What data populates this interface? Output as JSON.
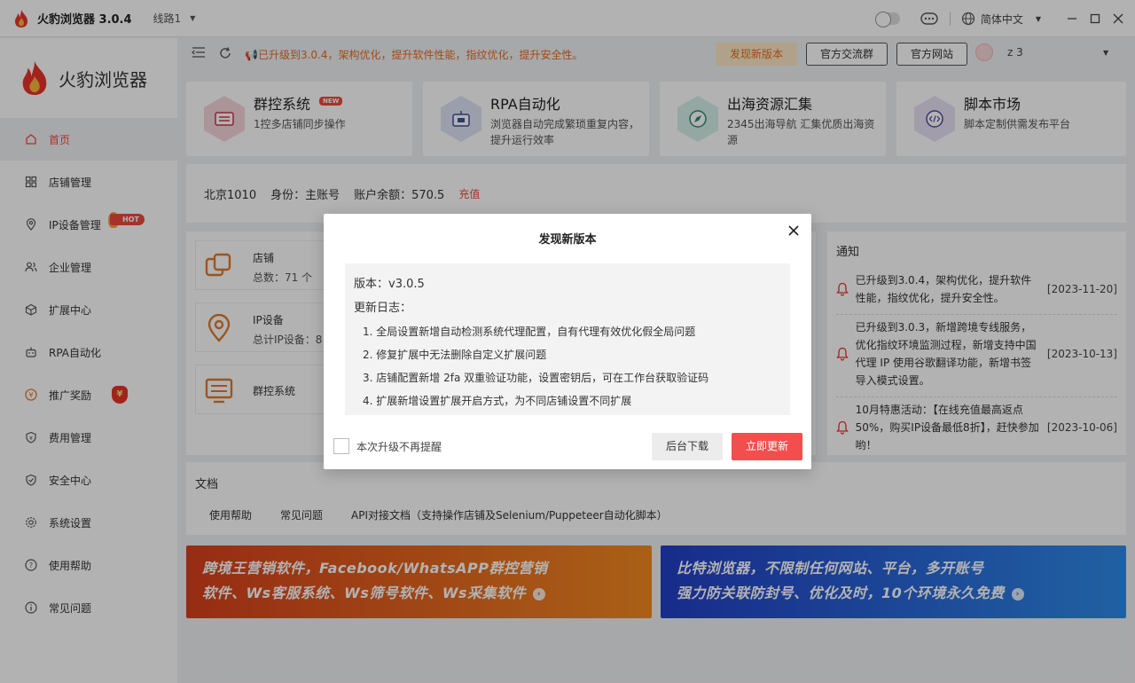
{
  "titlebar": {
    "app_name": "火豹浏览器 3.0.4",
    "line_label": "线路1",
    "language": "简体中文"
  },
  "sidebar": {
    "brand": "火豹浏览器",
    "hot_label": "HOT",
    "items": [
      {
        "label": "首页",
        "icon": "home-icon"
      },
      {
        "label": "店铺管理",
        "icon": "grid-icon"
      },
      {
        "label": "IP设备管理",
        "icon": "location-icon"
      },
      {
        "label": "企业管理",
        "icon": "users-icon"
      },
      {
        "label": "扩展中心",
        "icon": "cube-icon"
      },
      {
        "label": "RPA自动化",
        "icon": "robot-icon"
      },
      {
        "label": "推广奖励",
        "icon": "coin-icon"
      },
      {
        "label": "费用管理",
        "icon": "shield-yen-icon"
      },
      {
        "label": "安全中心",
        "icon": "shield-check-icon"
      },
      {
        "label": "系统设置",
        "icon": "gear-icon"
      },
      {
        "label": "使用帮助",
        "icon": "help-icon"
      },
      {
        "label": "常见问题",
        "icon": "info-icon"
      }
    ]
  },
  "topbar": {
    "notice": "已升级到3.0.4，架构优化，提升软件性能，指纹优化，提升安全性。",
    "new_version_btn": "发现新版本",
    "group_btn": "官方交流群",
    "site_btn": "官方网站",
    "username": "z                  3"
  },
  "features": [
    {
      "title": "群控系统",
      "desc": "1控多店铺同步操作",
      "badge": "NEW",
      "color": "#f7d6dc"
    },
    {
      "title": "RPA自动化",
      "desc": "浏览器自动完成繁琐重复内容，提升运行效率",
      "color": "#dfe4f5"
    },
    {
      "title": "出海资源汇集",
      "desc": "2345出海导航 汇集优质出海资源",
      "color": "#d6efe9"
    },
    {
      "title": "脚本市场",
      "desc": "脚本定制供需发布平台",
      "color": "#e7e1f5"
    }
  ],
  "account": {
    "region": "北京1010",
    "identity": "身份：主账号",
    "balance": "账户余额：570.5",
    "recharge": "充值"
  },
  "stats": {
    "store_title": "店铺",
    "store_sub": "总数：71 个",
    "ip_title": "IP设备",
    "ip_sub": "总计IP设备：8",
    "group_title": "群控系统"
  },
  "notices": {
    "title": "通知",
    "items": [
      {
        "text": "已升级到3.0.4，架构优化，提升软件性能，指纹优化，提升安全性。",
        "date": "[2023-11-20]"
      },
      {
        "text": "已升级到3.0.3，新增跨境专线服务，优化指纹环境监测过程，新增支持中国代理 IP 使用谷歌翻译功能，新增书签导入模式设置。",
        "date": "[2023-10-13]"
      },
      {
        "text": "10月特惠活动：【在线充值最高返点50%，购买IP设备最低8折】，赶快参加哟！",
        "date": "[2023-10-06]"
      }
    ]
  },
  "docs": {
    "title": "文档",
    "links": [
      "使用帮助",
      "常见问题",
      "API对接文档（支持操作店铺及Selenium/Puppeteer自动化脚本）"
    ]
  },
  "banners": {
    "left_line1": "跨境王营销软件，Facebook/WhatsAPP群控营销",
    "left_line2": "软件、Ws客服系统、Ws筛号软件、Ws采集软件",
    "right_line1": "比特浏览器，不限制任何网站、平台，多开账号",
    "right_line2": "强力防关联防封号、优化及时，10个环境永久免费"
  },
  "modal": {
    "title": "发现新版本",
    "version": "版本：v3.0.5",
    "log_title": "更新日志：",
    "log_items": [
      "1. 全局设置新增自动检测系统代理配置，自有代理有效优化假全局问题",
      "2. 修复扩展中无法删除自定义扩展问题",
      "3. 店铺配置新增 2fa 双重验证功能，设置密钥后，可在工作台获取验证码",
      "4. 扩展新增设置扩展开启方式，为不同店铺设置不同扩展"
    ],
    "checkbox_label": "本次升级不再提醒",
    "bg_download": "后台下载",
    "update_now": "立即更新"
  },
  "colors": {
    "accent": "#f04a3a",
    "notice_orange": "#e86a1f",
    "update_button": "#f34e4e"
  }
}
